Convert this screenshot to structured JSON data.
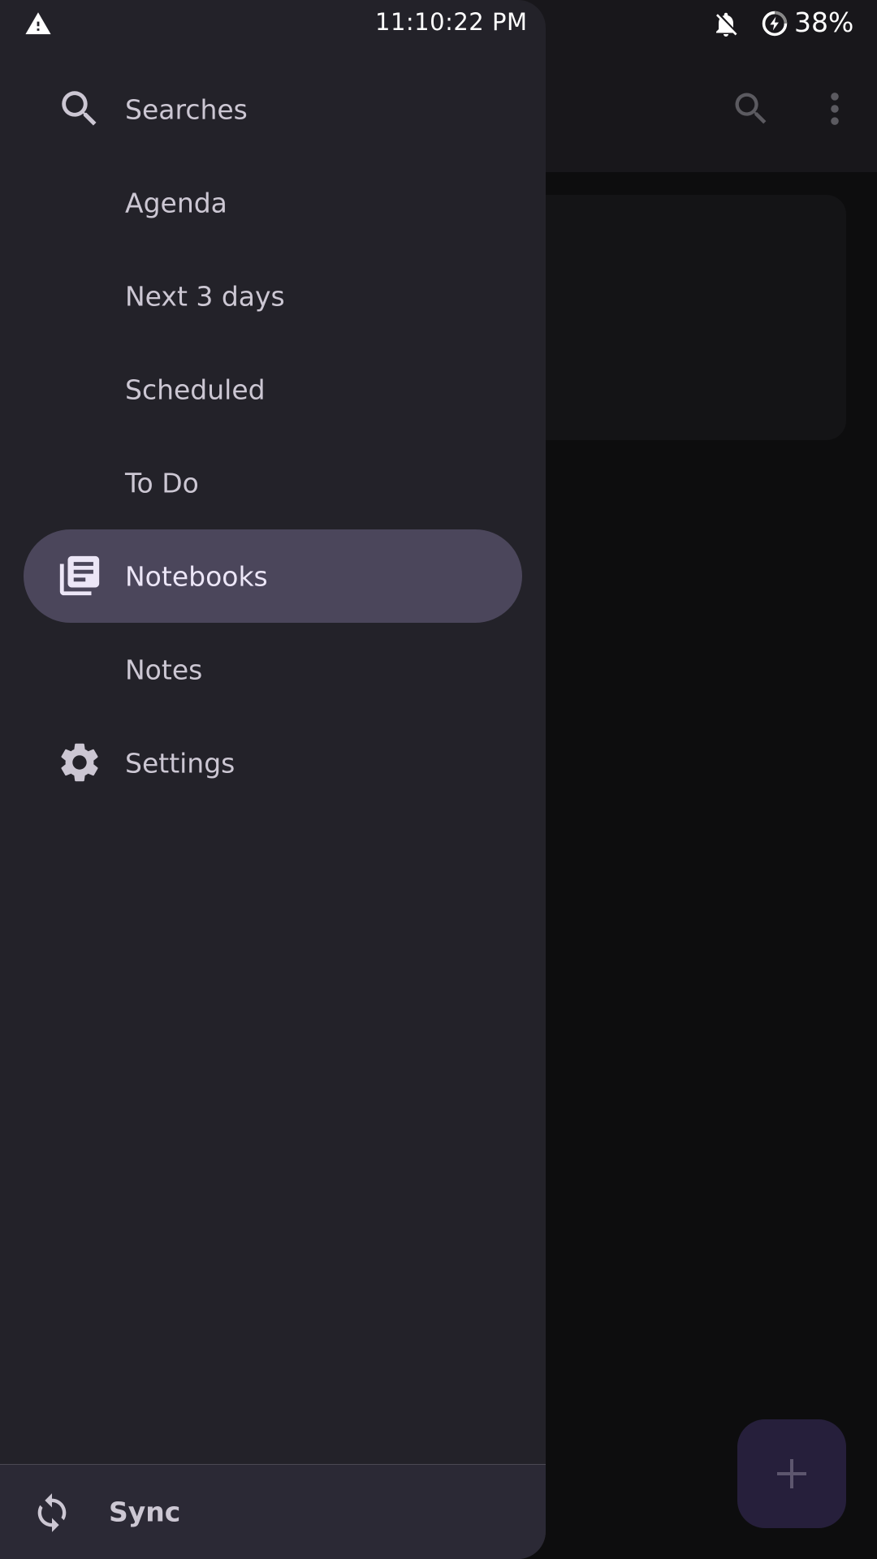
{
  "status_bar": {
    "time": "11:10:22 PM",
    "battery": "38%",
    "icons": [
      "warning-icon",
      "bell-off-icon",
      "battery-saver-icon"
    ]
  },
  "drawer": {
    "items": [
      {
        "label": "Searches",
        "icon": "search-icon",
        "active": false
      },
      {
        "label": "Agenda",
        "icon": "",
        "active": false
      },
      {
        "label": "Next 3 days",
        "icon": "",
        "active": false
      },
      {
        "label": "Scheduled",
        "icon": "",
        "active": false
      },
      {
        "label": "To Do",
        "icon": "",
        "active": false
      },
      {
        "label": "Notebooks",
        "icon": "notebooks-icon",
        "active": true
      },
      {
        "label": "Notes",
        "icon": "",
        "active": false
      },
      {
        "label": "Settings",
        "icon": "gear-icon",
        "active": false
      }
    ],
    "sync": {
      "label": "Sync",
      "icon": "sync-icon"
    }
  },
  "app_bar": {
    "icons": [
      "search-icon",
      "more-vert-icon"
    ]
  },
  "fab": {
    "icon": "plus-icon"
  },
  "colors": {
    "drawer_bg": "#232229",
    "active_item_bg": "#4b465b",
    "text": "#ccc7d3",
    "active_text": "#ece6f7",
    "fab_bg": "#261f3b"
  }
}
